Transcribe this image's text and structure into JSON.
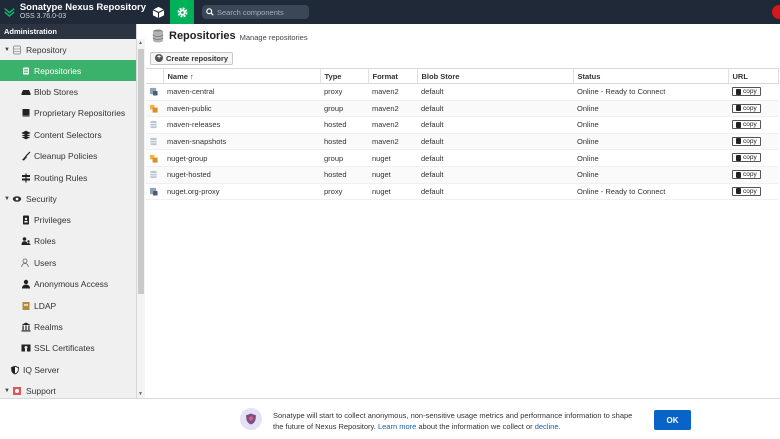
{
  "header": {
    "brand_title": "Sonatype Nexus Repository",
    "brand_version": "OSS 3.76.0-03",
    "search_placeholder": "Search components"
  },
  "sidebar": {
    "section_title": "Administration",
    "repository_group": "Repository",
    "repository_items": [
      {
        "label": "Repositories",
        "icon": "list-icon",
        "active": true
      },
      {
        "label": "Blob Stores",
        "icon": "hdd-icon"
      },
      {
        "label": "Proprietary Repositories",
        "icon": "book-icon"
      },
      {
        "label": "Content Selectors",
        "icon": "layers-icon"
      },
      {
        "label": "Cleanup Policies",
        "icon": "broom-icon"
      },
      {
        "label": "Routing Rules",
        "icon": "signs-icon"
      }
    ],
    "security_group": "Security",
    "security_items": [
      {
        "label": "Privileges",
        "icon": "id-badge-icon"
      },
      {
        "label": "Roles",
        "icon": "users-icon"
      },
      {
        "label": "Users",
        "icon": "user-cog-icon"
      },
      {
        "label": "Anonymous Access",
        "icon": "user-icon"
      },
      {
        "label": "LDAP",
        "icon": "book-ldap-icon"
      },
      {
        "label": "Realms",
        "icon": "building-icon"
      },
      {
        "label": "SSL Certificates",
        "icon": "certificate-icon"
      }
    ],
    "iq_server": "IQ Server",
    "support_group": "Support"
  },
  "main": {
    "title": "Repositories",
    "subtitle": "Manage repositories",
    "create_button": "Create repository",
    "columns": [
      "Name ↑",
      "Type",
      "Format",
      "Blob Store",
      "Status",
      "URL"
    ],
    "copy_label": "copy",
    "rows": [
      {
        "name": "maven-central",
        "type": "proxy",
        "format": "maven2",
        "blob_store": "default",
        "status": "Online - Ready to Connect"
      },
      {
        "name": "maven-public",
        "type": "group",
        "format": "maven2",
        "blob_store": "default",
        "status": "Online"
      },
      {
        "name": "maven-releases",
        "type": "hosted",
        "format": "maven2",
        "blob_store": "default",
        "status": "Online"
      },
      {
        "name": "maven-snapshots",
        "type": "hosted",
        "format": "maven2",
        "blob_store": "default",
        "status": "Online"
      },
      {
        "name": "nuget-group",
        "type": "group",
        "format": "nuget",
        "blob_store": "default",
        "status": "Online"
      },
      {
        "name": "nuget-hosted",
        "type": "hosted",
        "format": "nuget",
        "blob_store": "default",
        "status": "Online"
      },
      {
        "name": "nuget.org-proxy",
        "type": "proxy",
        "format": "nuget",
        "blob_store": "default",
        "status": "Online - Ready to Connect"
      }
    ]
  },
  "consent": {
    "text_1": "Sonatype will start to collect anonymous, non-sensitive usage metrics and performance information to shape the future of Nexus Repository.",
    "learn_more": "Learn more",
    "text_2": "about the information we collect or",
    "decline": "decline",
    "text_3": ".",
    "ok_label": "OK"
  },
  "colors": {
    "topbar": "#1f2937",
    "accent_green": "#3bb26b",
    "ok_blue": "#0a63c9",
    "proxy_icon": "#5a6b7d",
    "group_icon": "#e6a33c",
    "hosted_icon": "#8fa3b8"
  }
}
